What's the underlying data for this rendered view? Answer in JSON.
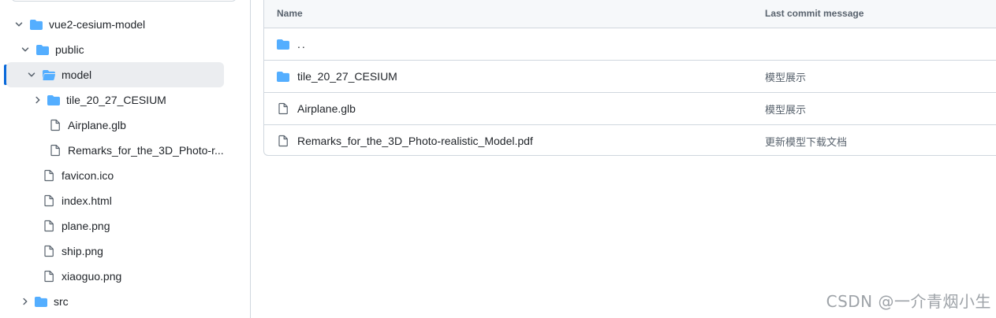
{
  "colors": {
    "folder": "#54aeff",
    "file_outline": "#59636e",
    "selected_bg": "#ebedf0",
    "accent": "#0969da",
    "border": "#d0d7de"
  },
  "tree": {
    "items": [
      {
        "label": "vue2-cesium-model",
        "icon": "folder-icon",
        "chevron": "chevron-down-icon"
      },
      {
        "label": "public",
        "icon": "folder-icon",
        "chevron": "chevron-down-icon"
      },
      {
        "label": "model",
        "icon": "folder-open-icon",
        "chevron": "chevron-down-icon",
        "selected": true
      },
      {
        "label": "tile_20_27_CESIUM",
        "icon": "folder-icon",
        "chevron": "chevron-right-icon"
      },
      {
        "label": "Airplane.glb",
        "icon": "file-icon"
      },
      {
        "label": "Remarks_for_the_3D_Photo-r...",
        "icon": "file-icon"
      },
      {
        "label": "favicon.ico",
        "icon": "file-icon"
      },
      {
        "label": "index.html",
        "icon": "file-icon"
      },
      {
        "label": "plane.png",
        "icon": "file-icon"
      },
      {
        "label": "ship.png",
        "icon": "file-icon"
      },
      {
        "label": "xiaoguo.png",
        "icon": "file-icon"
      },
      {
        "label": "src",
        "icon": "folder-icon",
        "chevron": "chevron-right-icon"
      }
    ]
  },
  "table": {
    "headers": {
      "name": "Name",
      "message": "Last commit message"
    },
    "rows": [
      {
        "name": "..",
        "icon": "folder-icon",
        "message": ""
      },
      {
        "name": "tile_20_27_CESIUM",
        "icon": "folder-icon",
        "message": "模型展示"
      },
      {
        "name": "Airplane.glb",
        "icon": "file-icon",
        "message": "模型展示"
      },
      {
        "name": "Remarks_for_the_3D_Photo-realistic_Model.pdf",
        "icon": "file-icon",
        "message": "更新模型下载文档"
      }
    ]
  },
  "watermark": "CSDN @一介青烟小生"
}
